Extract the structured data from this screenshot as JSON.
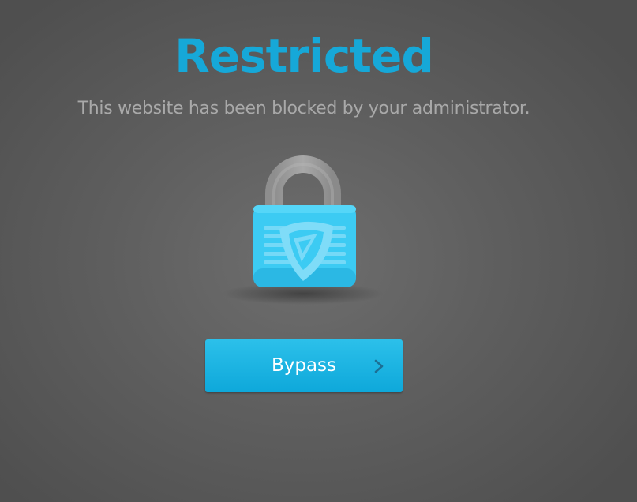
{
  "page": {
    "title": "Restricted",
    "message": "This website has been blocked by your administrator."
  },
  "lock_icon": {
    "name": "padlock-shield-icon",
    "accent_color": "#3ccbf3",
    "shackle_color": "#9a9a9a"
  },
  "bypass_button": {
    "label": "Bypass",
    "icon": "chevron-right-icon",
    "color": "#19b3e3"
  },
  "colors": {
    "title": "#16a8d8",
    "background": "#5f5f5f",
    "message": "#a9a9a9"
  }
}
